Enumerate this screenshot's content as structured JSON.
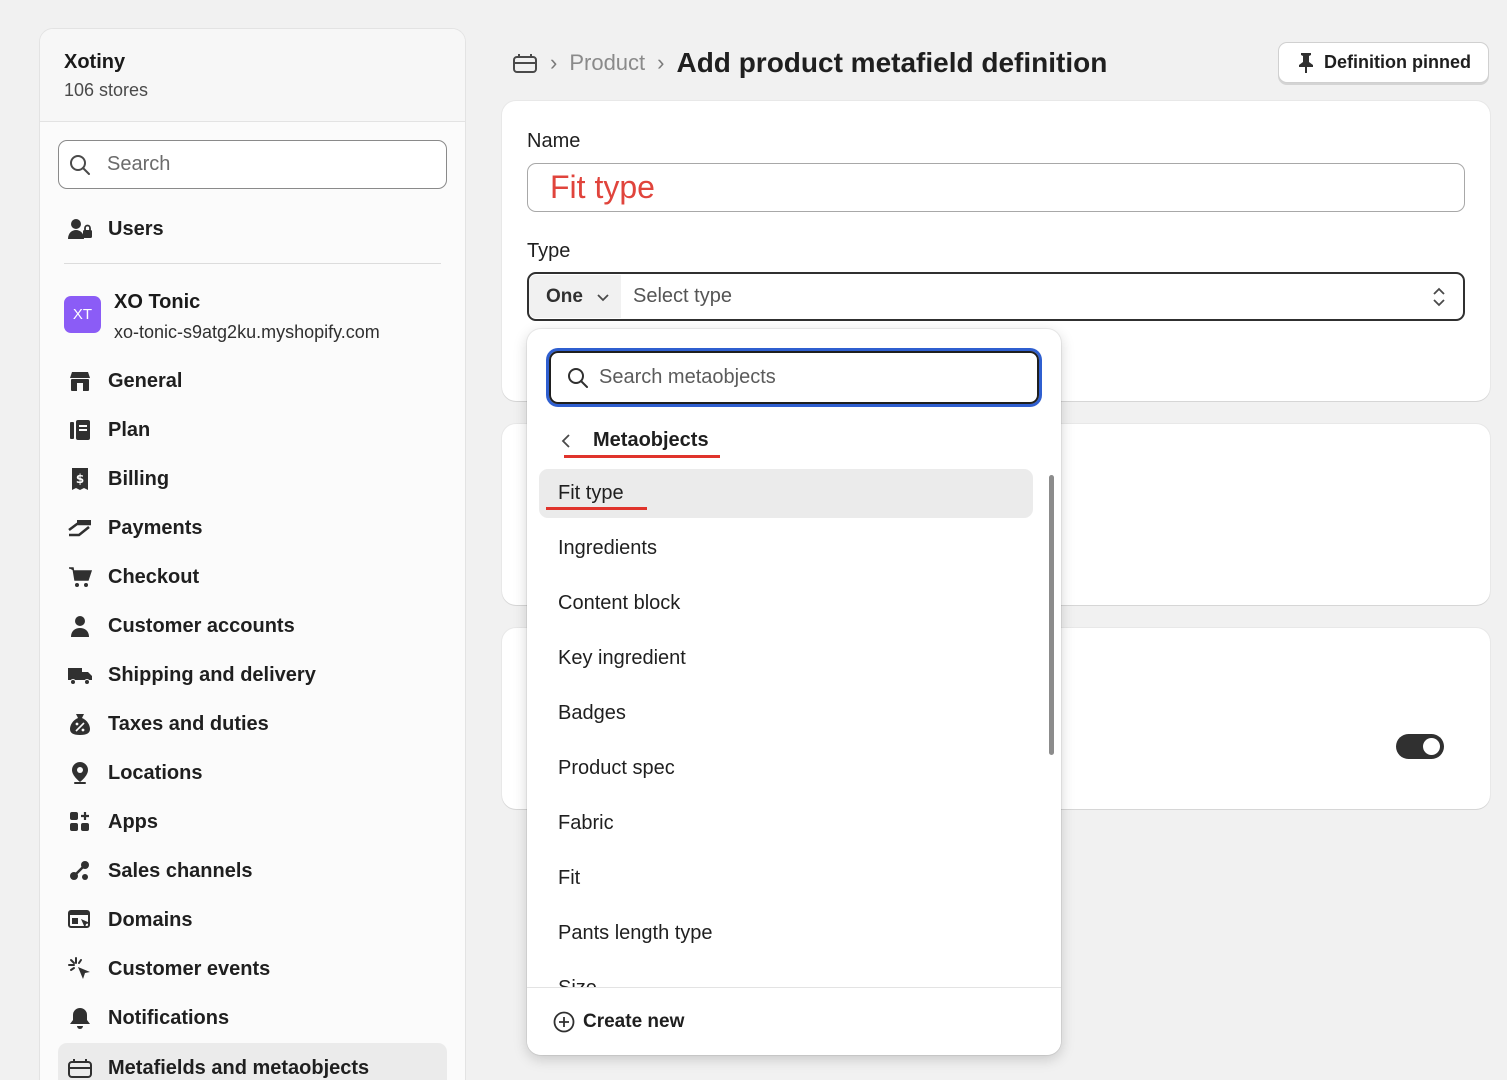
{
  "sidebar": {
    "org": {
      "name": "Xotiny",
      "stores_count": "106 stores"
    },
    "search": {
      "placeholder": "Search"
    },
    "users_label": "Users",
    "store": {
      "initials": "XT",
      "name": "XO Tonic",
      "url": "xo-tonic-s9atg2ku.myshopify.com",
      "avatar_color": "#8b5cf6"
    },
    "items": [
      {
        "label": "General",
        "icon": "store-icon"
      },
      {
        "label": "Plan",
        "icon": "plan-icon"
      },
      {
        "label": "Billing",
        "icon": "billing-icon"
      },
      {
        "label": "Payments",
        "icon": "payments-icon"
      },
      {
        "label": "Checkout",
        "icon": "cart-icon"
      },
      {
        "label": "Customer accounts",
        "icon": "person-icon"
      },
      {
        "label": "Shipping and delivery",
        "icon": "truck-icon"
      },
      {
        "label": "Taxes and duties",
        "icon": "tax-icon"
      },
      {
        "label": "Locations",
        "icon": "location-icon"
      },
      {
        "label": "Apps",
        "icon": "apps-icon"
      },
      {
        "label": "Sales channels",
        "icon": "channels-icon"
      },
      {
        "label": "Domains",
        "icon": "domains-icon"
      },
      {
        "label": "Customer events",
        "icon": "cursor-icon"
      },
      {
        "label": "Notifications",
        "icon": "bell-icon"
      },
      {
        "label": "Metafields and metaobjects",
        "icon": "metafields-icon"
      }
    ]
  },
  "header": {
    "breadcrumb_prev": "Product",
    "title": "Add product metafield definition",
    "pin_button": "Definition pinned"
  },
  "form": {
    "name_label": "Name",
    "name_value": "Fit type",
    "type_label": "Type",
    "cardinality": "One",
    "type_placeholder": "Select type"
  },
  "dropdown": {
    "search_placeholder": "Search metaobjects",
    "back_label": "Metaobjects",
    "items": [
      "Fit type",
      "Ingredients",
      "Content block",
      "Key ingredient",
      "Badges",
      "Product spec",
      "Fabric",
      "Fit",
      "Pants length type",
      "Size"
    ],
    "selected_index": 0,
    "create_new": "Create new"
  },
  "colors": {
    "accent_red": "#e0342c",
    "focus_blue": "#2f5fd0",
    "background": "#f1f1f1"
  }
}
